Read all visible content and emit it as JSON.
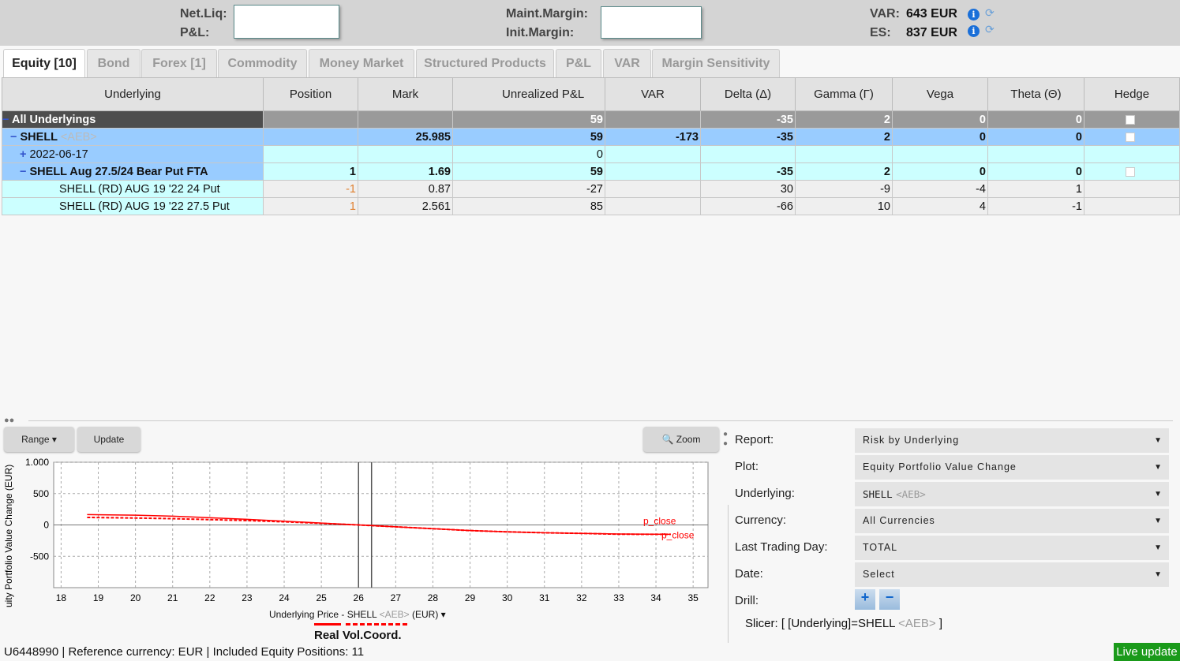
{
  "header": {
    "netliq_label": "Net.Liq:",
    "pnl_label": "P&L:",
    "maint_label": "Maint.Margin:",
    "init_label": "Init.Margin:",
    "var_label": "VAR:",
    "var_value": "643 EUR",
    "es_label": "ES:",
    "es_value": "837 EUR"
  },
  "tabs": [
    "Equity [10]",
    "Bond",
    "Forex [1]",
    "Commodity",
    "Money Market",
    "Structured Products",
    "P&L",
    "VAR",
    "Margin Sensitivity"
  ],
  "table": {
    "columns": [
      "Underlying",
      "Position",
      "Mark",
      "Unrealized P&L",
      "VAR",
      "Delta (Δ)",
      "Gamma (Γ)",
      "Vega",
      "Theta (Θ)",
      "Hedge"
    ],
    "rows": [
      {
        "name": "All Underlyings",
        "exch": "",
        "position": "",
        "mark": "",
        "upnl": "59",
        "var": "",
        "delta": "-35",
        "gamma": "2",
        "vega": "0",
        "theta": "0",
        "hedge": true
      },
      {
        "name": "SHELL",
        "exch": "<AEB>",
        "position": "",
        "mark": "25.985",
        "upnl": "59",
        "var": "-173",
        "delta": "-35",
        "gamma": "2",
        "vega": "0",
        "theta": "0",
        "hedge": true
      },
      {
        "name": "2022-06-17",
        "exch": "",
        "position": "",
        "mark": "",
        "upnl": "0",
        "var": "",
        "delta": "",
        "gamma": "",
        "vega": "",
        "theta": "",
        "hedge": false
      },
      {
        "name": "SHELL Aug 27.5/24 Bear Put FTA",
        "exch": "",
        "position": "1",
        "mark": "1.69",
        "upnl": "59",
        "var": "",
        "delta": "-35",
        "gamma": "2",
        "vega": "0",
        "theta": "0",
        "hedge": true
      },
      {
        "name": "SHELL (RD) AUG 19 '22 24 Put",
        "exch": "",
        "position": "-1",
        "mark": "0.87",
        "upnl": "-27",
        "var": "",
        "delta": "30",
        "gamma": "-9",
        "vega": "-4",
        "theta": "1",
        "hedge": false
      },
      {
        "name": "SHELL (RD) AUG 19 '22 27.5 Put",
        "exch": "",
        "position": "1",
        "mark": "2.561",
        "upnl": "85",
        "var": "",
        "delta": "-66",
        "gamma": "10",
        "vega": "4",
        "theta": "-1",
        "hedge": false
      }
    ]
  },
  "chart_toolbar": {
    "range": "Range",
    "update": "Update",
    "zoom": "Zoom"
  },
  "chart_data": {
    "type": "line",
    "xlabel": "Underlying Price - SHELL",
    "xlabel_exch": "<AEB>",
    "xlabel_unit": "(EUR)",
    "ylabel": "uity Portfolio Value Change (EUR)",
    "xlim": [
      17.8,
      35.4
    ],
    "ylim": [
      -1000,
      1000
    ],
    "xticks": [
      "18",
      "19",
      "20",
      "21",
      "22",
      "23",
      "24",
      "25",
      "26",
      "27",
      "28",
      "29",
      "30",
      "31",
      "32",
      "33",
      "34",
      "35"
    ],
    "yticks": [
      {
        "v": 1000,
        "t": "1.000"
      },
      {
        "v": 500,
        "t": "500"
      },
      {
        "v": 0,
        "t": "0"
      },
      {
        "v": -500,
        "t": "-500"
      }
    ],
    "grid": true,
    "vlines": [
      26,
      26.35
    ],
    "series": [
      {
        "name": "Real",
        "style": "solid",
        "color": "#ff0000",
        "label": "p_close",
        "x": [
          18.7,
          20,
          21,
          22,
          23,
          24,
          25,
          26,
          27,
          28,
          29,
          30,
          31,
          32,
          33,
          34.4
        ],
        "y": [
          165,
          155,
          140,
          115,
          90,
          60,
          30,
          0,
          -30,
          -60,
          -90,
          -110,
          -125,
          -135,
          -145,
          -150
        ]
      },
      {
        "name": "Vol.Coord.",
        "style": "dashed",
        "color": "#ff0000",
        "label": "p_close",
        "x": [
          18.7,
          20,
          21,
          22,
          23,
          24,
          25,
          26,
          27,
          28,
          29,
          30,
          31,
          32,
          33,
          34.4
        ],
        "y": [
          120,
          110,
          100,
          85,
          70,
          50,
          25,
          0,
          -30,
          -60,
          -90,
          -110,
          -125,
          -135,
          -148,
          -150
        ]
      }
    ]
  },
  "legend": {
    "real": "Real",
    "vol": "Vol.Coord."
  },
  "controls": [
    {
      "label": "Report:",
      "value": "Risk by Underlying"
    },
    {
      "label": "Plot:",
      "value": "Equity Portfolio Value Change"
    },
    {
      "label": "Underlying:",
      "value": "SHELL",
      "exch": "<AEB>"
    },
    {
      "label": "Currency:",
      "value": "All Currencies"
    },
    {
      "label": "Last Trading Day:",
      "value": "TOTAL"
    },
    {
      "label": "Date:",
      "value": "Select"
    }
  ],
  "drill_label": "Drill:",
  "slicer": {
    "prefix": "Slicer: [ [Underlying]=SHELL",
    "exch": "<AEB>",
    "suffix": "]"
  },
  "status": {
    "text": "U6448990 | Reference currency: EUR | Included Equity Positions: 11",
    "live": "Live update"
  }
}
